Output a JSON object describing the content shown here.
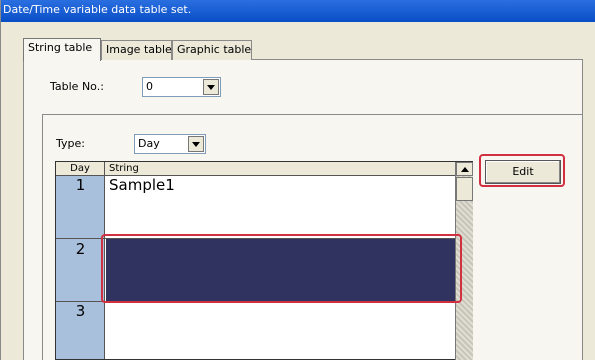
{
  "window": {
    "title": "Date/Time variable data table set."
  },
  "tabs": [
    {
      "label": "String table"
    },
    {
      "label": "Image table"
    },
    {
      "label": "Graphic table"
    }
  ],
  "table_no": {
    "label": "Table No.:",
    "value": "0"
  },
  "type": {
    "label": "Type:",
    "value": "Day"
  },
  "grid": {
    "headers": {
      "day": "Day",
      "string": "String"
    },
    "rows": [
      {
        "day": "1",
        "string": "Sample1"
      },
      {
        "day": "2",
        "string": ""
      },
      {
        "day": "3",
        "string": ""
      }
    ],
    "selected_color": "#303360"
  },
  "buttons": {
    "edit": "Edit"
  },
  "colors": {
    "highlight": "#d03040",
    "day_column": "#a8c0dc",
    "title_bar": "#0a4ec6"
  }
}
